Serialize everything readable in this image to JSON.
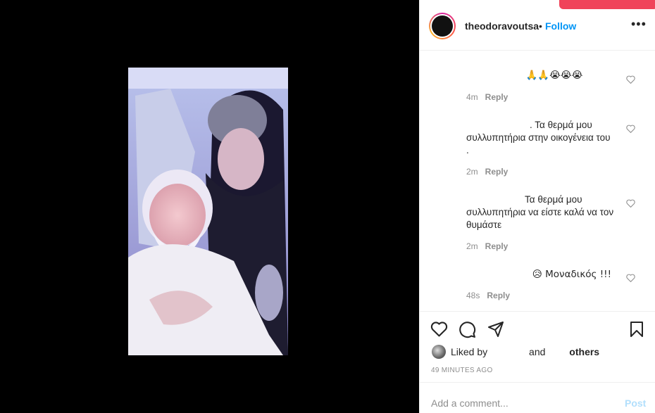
{
  "post": {
    "username": "theodoravoutsa",
    "dot": "•",
    "follow_label": "Follow",
    "more_label": "•••"
  },
  "comments": [
    {
      "text": "🙏🙏😭😭😭",
      "time": "4m",
      "reply_label": "Reply"
    },
    {
      "text": ". Τα θερμά μου συλλυπητήρια στην οικογένεια του .",
      "time": "2m",
      "reply_label": "Reply"
    },
    {
      "text": "Τα θερμά μου συλλυπητήρια να είστε καλά να τον θυμάστε",
      "time": "2m",
      "reply_label": "Reply"
    },
    {
      "text": "😥 Μοναδικός !!!",
      "time": "48s",
      "reply_label": "Reply"
    }
  ],
  "likes": {
    "liked_by": "Liked by",
    "and": "and",
    "others": "others"
  },
  "time_ago": "49 MINUTES AGO",
  "add_comment": {
    "placeholder": "Add a comment...",
    "post_label": "Post"
  },
  "colors": {
    "accent": "#0095f6",
    "post_disabled": "#b2dffc",
    "toast": "#f0435a",
    "media_bg": "#000000"
  },
  "icons": [
    "heart-icon",
    "comment-icon",
    "share-icon",
    "bookmark-icon",
    "more-icon"
  ]
}
